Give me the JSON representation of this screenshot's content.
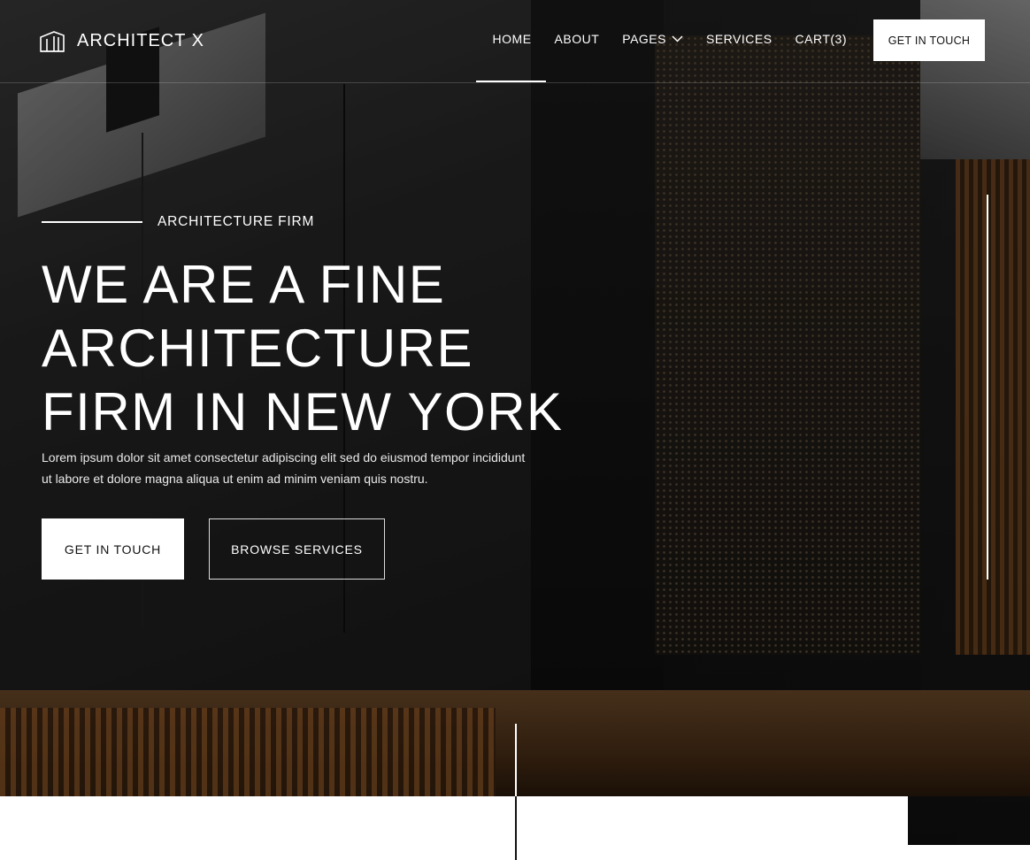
{
  "brand": {
    "name": "ARCHITECT X",
    "logo_icon": "building-outline-icon"
  },
  "nav": {
    "items": [
      {
        "label": "HOME",
        "active": true
      },
      {
        "label": "ABOUT"
      },
      {
        "label": "PAGES",
        "has_dropdown": true
      },
      {
        "label": "SERVICES"
      },
      {
        "label": "CART(3)"
      }
    ],
    "cta": "GET IN TOUCH"
  },
  "hero": {
    "eyebrow": "ARCHITECTURE FIRM",
    "headline_lines": [
      "WE ARE A FINE",
      "ARCHITECTURE",
      "FIRM IN NEW YORK"
    ],
    "description_lines": [
      "Lorem ipsum dolor sit amet consectetur adipiscing elit sed do eiusmod tempor incididunt",
      "ut labore et dolore magna aliqua ut enim ad minim veniam quis nostru."
    ],
    "primary_button": "GET IN TOUCH",
    "secondary_button": "BROWSE SERVICES"
  },
  "colors": {
    "text": "#ffffff",
    "button_bg": "#ffffff",
    "button_text": "#111111"
  }
}
